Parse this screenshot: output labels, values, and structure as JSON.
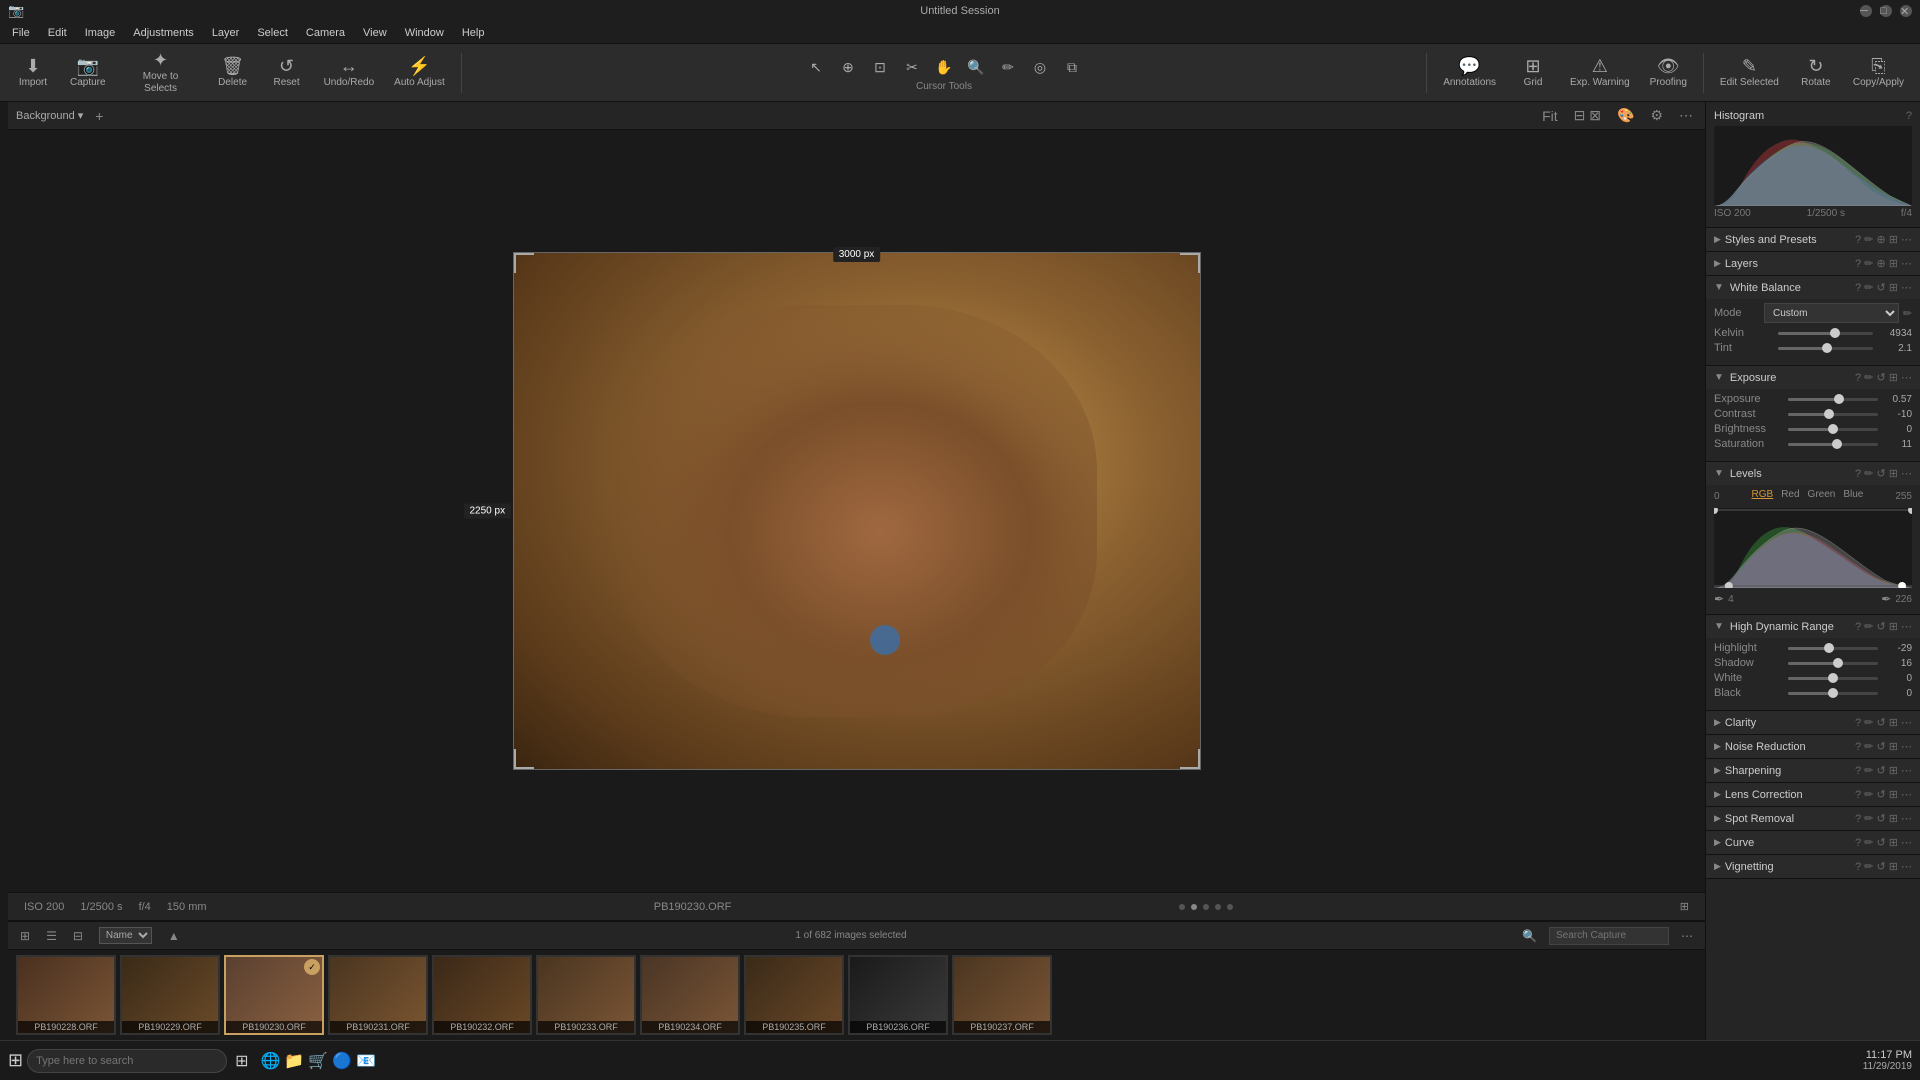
{
  "titlebar": {
    "title": "Untitled Session",
    "min": "─",
    "max": "□",
    "close": "✕"
  },
  "menubar": {
    "items": [
      "File",
      "Edit",
      "Image",
      "Adjustments",
      "Layer",
      "Select",
      "Camera",
      "View",
      "Window",
      "Help"
    ]
  },
  "toolbar": {
    "import_label": "Import",
    "capture_label": "Capture",
    "move_to_selects_label": "Move to Selects",
    "delete_label": "Delete",
    "reset_label": "Reset",
    "undo_redo_label": "Undo/Redo",
    "auto_adjust_label": "Auto Adjust",
    "annotations_label": "Annotations",
    "grid_label": "Grid",
    "exp_warning_label": "Exp. Warning",
    "proofing_label": "Proofing",
    "edit_selected_label": "Edit Selected",
    "rotate_label": "Rotate",
    "copy_apply_label": "Copy/Apply",
    "cursor_tools_label": "Cursor Tools"
  },
  "canvas": {
    "dim_top": "3000 px",
    "dim_left": "2250 px",
    "iso": "ISO 200",
    "shutter": "1/2500 s",
    "aperture": "f/4",
    "focal": "150 mm",
    "filename": "PB190230.ORF",
    "selection_info": "1 of 682 images selected",
    "fit_label": "Fit"
  },
  "right_panel": {
    "histogram": {
      "label": "Histogram",
      "iso": "ISO 200",
      "shutter": "1/2500 s",
      "aperture": "f/4"
    },
    "styles_presets": {
      "label": "Styles and Presets"
    },
    "layers": {
      "label": "Layers"
    },
    "white_balance": {
      "label": "White Balance",
      "mode_label": "Mode",
      "mode_value": "Custom",
      "kelvin_label": "Kelvin",
      "kelvin_value": "4934",
      "tint_label": "Tint",
      "tint_value": "2.1"
    },
    "exposure": {
      "label": "Exposure",
      "exposure_label": "Exposure",
      "exposure_value": "0.57",
      "contrast_label": "Contrast",
      "contrast_value": "-10",
      "brightness_label": "Brightness",
      "brightness_value": "0",
      "saturation_label": "Saturation",
      "saturation_value": "11"
    },
    "levels": {
      "label": "Levels",
      "tabs": [
        "RGB",
        "Red",
        "Green",
        "Blue"
      ],
      "active_tab": "RGB",
      "min_val": "0",
      "max_val": "255",
      "bottom_min": "4",
      "bottom_max": "226"
    },
    "hdr": {
      "label": "High Dynamic Range",
      "highlight_label": "Highlight",
      "highlight_value": "-29",
      "shadow_label": "Shadow",
      "shadow_value": "16",
      "white_label": "White",
      "white_value": "0",
      "black_label": "Black",
      "black_value": "0"
    },
    "clarity": {
      "label": "Clarity"
    },
    "noise_reduction": {
      "label": "Noise Reduction"
    },
    "sharpening": {
      "label": "Sharpening"
    },
    "lens_correction": {
      "label": "Lens Correction"
    },
    "spot_removal": {
      "label": "Spot Removal"
    },
    "curve": {
      "label": "Curve"
    },
    "vignetting": {
      "label": "Vignetting"
    }
  },
  "filmstrip": {
    "sort_label": "Name",
    "count_label": "1 of 682 images selected",
    "search_placeholder": "Search Capture",
    "images": [
      {
        "filename": "PB190228.ORF",
        "selected": false
      },
      {
        "filename": "PB190229.ORF",
        "selected": false
      },
      {
        "filename": "PB190230.ORF",
        "selected": true
      },
      {
        "filename": "PB190231.ORF",
        "selected": false
      },
      {
        "filename": "PB190232.ORF",
        "selected": false
      },
      {
        "filename": "PB190233.ORF",
        "selected": false
      },
      {
        "filename": "PB190234.ORF",
        "selected": false
      },
      {
        "filename": "PB190235.ORF",
        "selected": false
      },
      {
        "filename": "PB190236.ORF",
        "selected": false
      },
      {
        "filename": "PB190237.ORF",
        "selected": false
      }
    ]
  },
  "taskbar": {
    "time": "11:17 PM",
    "date": "11/29/2019"
  }
}
